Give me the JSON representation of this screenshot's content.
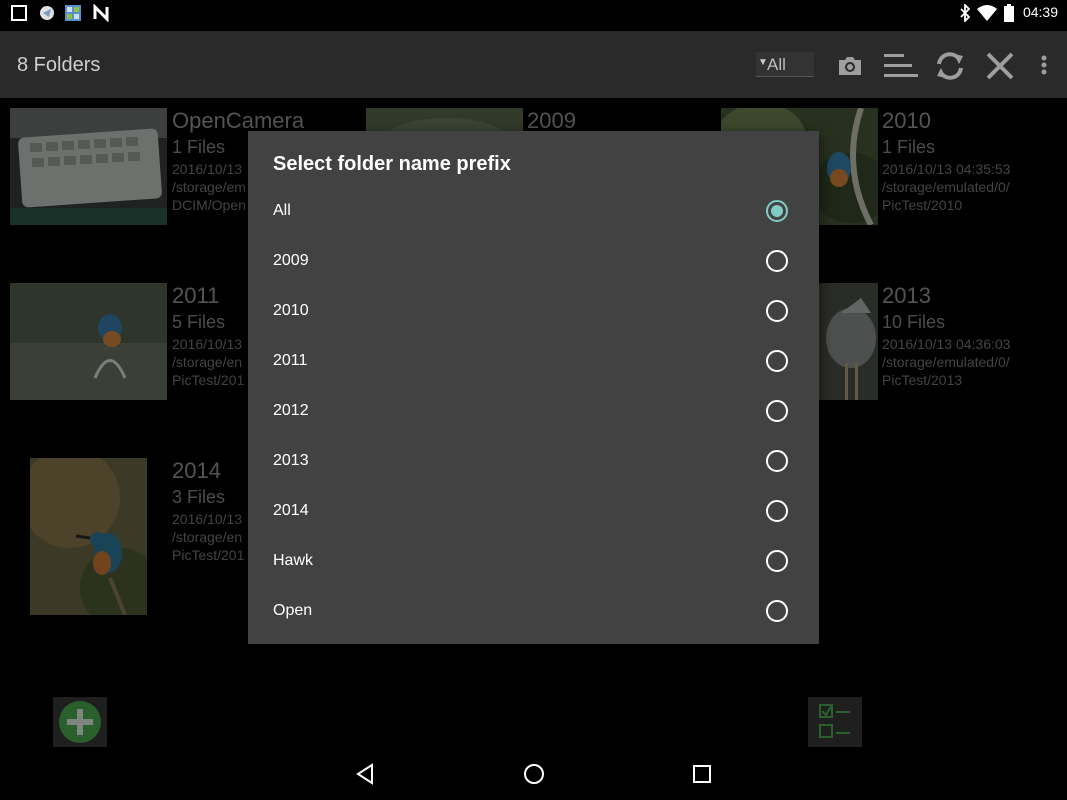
{
  "status_bar": {
    "time": "04:39",
    "left_icons": [
      "square-icon",
      "app-notification-icon",
      "gallery-notification-icon",
      "n-notification-icon"
    ],
    "right_icons": [
      "bluetooth-icon",
      "wifi-icon",
      "battery-icon"
    ]
  },
  "app_bar": {
    "title": "8 Folders",
    "prefix_filter_value": "All",
    "actions": [
      "camera-icon",
      "sort-icon",
      "refresh-icon",
      "close-icon",
      "overflow-menu-icon"
    ]
  },
  "folders": [
    {
      "name": "OpenCamera",
      "count": "1 Files",
      "date": "2016/10/13",
      "path1": "/storage/em",
      "path2": "DCIM/Open"
    },
    {
      "name": "2009",
      "count": "",
      "date": "",
      "path1": "",
      "path2": ""
    },
    {
      "name": "2010",
      "count": "1 Files",
      "date": "2016/10/13 04:35:53",
      "path1": "/storage/emulated/0/",
      "path2": "PicTest/2010"
    },
    {
      "name": "2011",
      "count": "5 Files",
      "date": "2016/10/13",
      "path1": "/storage/en",
      "path2": "PicTest/201"
    },
    {
      "name": "2013",
      "count": "10 Files",
      "date": "2016/10/13 04:36:03",
      "path1": "/storage/emulated/0/",
      "path2": "PicTest/2013"
    },
    {
      "name": "2014",
      "count": "3 Files",
      "date": "2016/10/13",
      "path1": "/storage/en",
      "path2": "PicTest/201"
    }
  ],
  "dialog": {
    "title": "Select folder name prefix",
    "options": [
      {
        "label": "All",
        "checked": true
      },
      {
        "label": "2009",
        "checked": false
      },
      {
        "label": "2010",
        "checked": false
      },
      {
        "label": "2011",
        "checked": false
      },
      {
        "label": "2012",
        "checked": false
      },
      {
        "label": "2013",
        "checked": false
      },
      {
        "label": "2014",
        "checked": false
      },
      {
        "label": "Hawk",
        "checked": false
      },
      {
        "label": "Open",
        "checked": false
      }
    ]
  },
  "bottom_buttons": [
    "add-folder-icon",
    "select-list-icon"
  ],
  "nav_bar": [
    "back-icon",
    "home-icon",
    "recents-icon"
  ],
  "colors": {
    "accent": "#80cbc4",
    "dialog_bg": "#424242",
    "app_bar_bg": "#2a2a2a",
    "add_green": "#4caf50"
  }
}
